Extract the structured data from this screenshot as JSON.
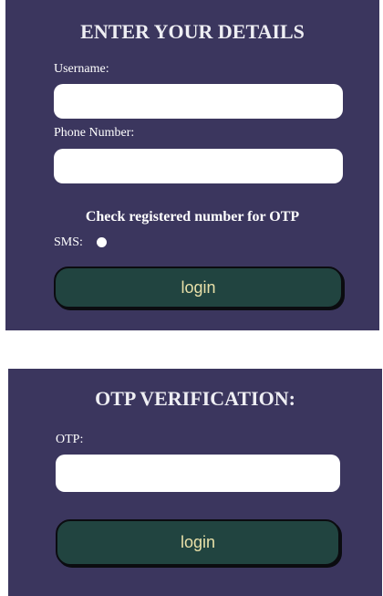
{
  "details_form": {
    "title": "ENTER YOUR DETAILS",
    "username_label": "Username:",
    "username_value": "",
    "phone_label": "Phone Number:",
    "phone_value": "",
    "note": "Check registered number for OTP",
    "sms_label": "SMS:",
    "login_label": "login"
  },
  "otp_form": {
    "title": "OTP VERIFICATION:",
    "otp_label": "OTP:",
    "otp_value": "",
    "login_label": "login"
  },
  "colors": {
    "panel_bg": "#3b365e",
    "button_bg": "#214440",
    "button_text": "#e8e0a8"
  }
}
